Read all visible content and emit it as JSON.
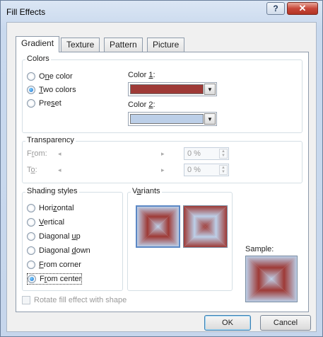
{
  "window": {
    "title": "Fill Effects",
    "help_label": "?",
    "close_label": "✕"
  },
  "tabs": [
    {
      "label": "Gradient",
      "active": true
    },
    {
      "label": "Texture"
    },
    {
      "label": "Pattern"
    },
    {
      "label": "Picture"
    }
  ],
  "colors_group": {
    "label": "Colors",
    "options": [
      {
        "pre": "O",
        "ul": "n",
        "post": "e color",
        "checked": false
      },
      {
        "pre": "",
        "ul": "T",
        "post": "wo colors",
        "checked": true
      },
      {
        "pre": "Pre",
        "ul": "s",
        "post": "et",
        "checked": false
      }
    ],
    "color1_label_pre": "Color ",
    "color1_label_ul": "1",
    "color1_label_post": ":",
    "color1": "#9e3a36",
    "color2_label_pre": "Color ",
    "color2_label_ul": "2",
    "color2_label_post": ":",
    "color2": "#bccfe8"
  },
  "transparency": {
    "label": "Transparency",
    "from_pre": "F",
    "from_ul": "r",
    "from_post": "om:",
    "to_pre": "T",
    "to_ul": "o",
    "to_post": ":",
    "from_value": "0 %",
    "to_value": "0 %"
  },
  "shading": {
    "label": "Shading styles",
    "options": [
      {
        "pre": "Hori",
        "ul": "z",
        "post": "ontal",
        "checked": false
      },
      {
        "pre": "",
        "ul": "V",
        "post": "ertical",
        "checked": false
      },
      {
        "pre": "Diagonal ",
        "ul": "u",
        "post": "p",
        "checked": false
      },
      {
        "pre": "Diagonal ",
        "ul": "d",
        "post": "own",
        "checked": false
      },
      {
        "pre": "",
        "ul": "F",
        "post": "rom corner",
        "checked": false
      },
      {
        "pre": "F",
        "ul": "r",
        "post": "om center",
        "checked": true
      }
    ]
  },
  "variants": {
    "pre": "V",
    "ul": "a",
    "post": "riants"
  },
  "sample_label": "Sample:",
  "rotate_label": "Rotate fill effect with shape",
  "buttons": {
    "ok": "OK",
    "cancel": "Cancel"
  }
}
